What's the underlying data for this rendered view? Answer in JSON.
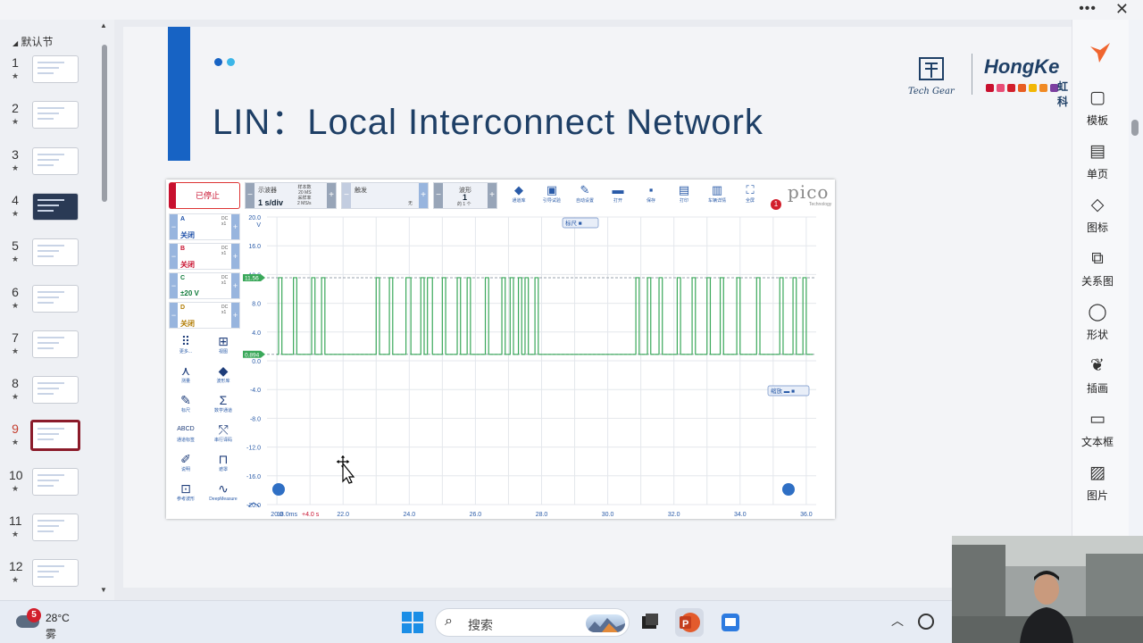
{
  "window": {
    "more_label": "•••",
    "close_label": "✕"
  },
  "thumbnails": {
    "section_label": "默认节",
    "collapse_glyph": "◢",
    "star": "★",
    "items": [
      {
        "num": "1"
      },
      {
        "num": "2"
      },
      {
        "num": "3"
      },
      {
        "num": "4"
      },
      {
        "num": "5"
      },
      {
        "num": "6"
      },
      {
        "num": "7"
      },
      {
        "num": "8"
      },
      {
        "num": "9"
      },
      {
        "num": "10"
      },
      {
        "num": "11"
      },
      {
        "num": "12"
      }
    ],
    "active_num": "9"
  },
  "slide": {
    "title": "LIN：Local  Interconnect  Network",
    "logo_techgear": "Tech Gear",
    "logo_hongkei": "HongKe",
    "logo_cn": "虹科",
    "brand_colors": [
      "#1763c4",
      "#3cb6e8",
      "#c8102e",
      "#e94e77",
      "#d21f2c",
      "#e85d22",
      "#f2b705",
      "#f08a24",
      "#7c3fa0"
    ]
  },
  "scope": {
    "stop_label": "已停止",
    "timebase": {
      "label": "示波器",
      "value": "1 s/div",
      "samples_label": "样本数",
      "samples": "20 MS",
      "rate_label": "采样率",
      "rate": "2 MS/s"
    },
    "trigger": {
      "label": "触发",
      "mode": "无"
    },
    "waveform": {
      "label": "波形",
      "value": "1",
      "of": "的 1 个"
    },
    "toolbar": [
      {
        "name": "channel-library",
        "icon": "◆",
        "label": "通道库"
      },
      {
        "name": "guided-test",
        "icon": "▣",
        "label": "引导试验"
      },
      {
        "name": "auto-setup",
        "icon": "✎",
        "label": "自动设置"
      },
      {
        "name": "open",
        "icon": "▬",
        "label": "打开"
      },
      {
        "name": "save",
        "icon": "▪",
        "label": "保存"
      },
      {
        "name": "print",
        "icon": "▤",
        "label": "打印"
      },
      {
        "name": "vehicle-details",
        "icon": "▥",
        "label": "车辆详情"
      },
      {
        "name": "fullscreen",
        "icon": "⛶",
        "label": "全屏"
      }
    ],
    "notification_count": "1",
    "brand": "pico",
    "brand_sub": "Technology",
    "channels": [
      {
        "name": "A",
        "coupling": "DC",
        "probe": "x1",
        "state": "关闭",
        "color": "#1d4fa8"
      },
      {
        "name": "B",
        "coupling": "DC",
        "probe": "x1",
        "state": "关闭",
        "color": "#c8102e"
      },
      {
        "name": "C",
        "coupling": "DC",
        "probe": "x1",
        "state": "±20 V",
        "color": "#0f7a3a"
      },
      {
        "name": "D",
        "coupling": "DC",
        "probe": "x1",
        "state": "关闭",
        "color": "#b07a00"
      }
    ],
    "tools": [
      {
        "name": "more",
        "icon": "⠿",
        "label": "更多..."
      },
      {
        "name": "views",
        "icon": "⊞",
        "label": "视图"
      },
      {
        "name": "measurements",
        "icon": "⋏",
        "label": "测量"
      },
      {
        "name": "channel-library-tool",
        "icon": "◆",
        "label": "波形库"
      },
      {
        "name": "ruler",
        "icon": "✎",
        "label": "标尺"
      },
      {
        "name": "math-channels",
        "icon": "Σ",
        "label": "数学通道"
      },
      {
        "name": "channel-labels",
        "icon": "ABCD",
        "label": "通道标签"
      },
      {
        "name": "serial-decoding",
        "icon": "⤲",
        "label": "串行译码"
      },
      {
        "name": "notes",
        "icon": "✐",
        "label": "说明"
      },
      {
        "name": "mask",
        "icon": "⊓",
        "label": "遮罩"
      },
      {
        "name": "reference-waveforms",
        "icon": "⊡",
        "label": "参考波形"
      },
      {
        "name": "deepmeasure",
        "icon": "∿",
        "label": "DeepMeasure"
      }
    ],
    "ruler_tag": "标尺 ■",
    "zoom_tag": "缩放 ▬ ■",
    "level_high": "11.56",
    "level_low": "0.894",
    "x_start": "18.0ms",
    "x_offset": "+4.0 s",
    "accent_green": "#3aa85a"
  },
  "chart_data": {
    "type": "line",
    "series": [
      {
        "name": "C",
        "transitions_s": [
          20.05,
          20.15,
          20.5,
          20.6,
          21.05,
          21.15,
          21.35,
          21.45,
          23.0,
          23.1,
          23.4,
          23.5,
          23.9,
          24.05,
          24.35,
          24.45,
          24.55,
          24.7,
          25.0,
          25.1,
          25.45,
          25.55,
          25.75,
          25.85,
          26.3,
          26.4,
          26.8,
          26.9,
          27.05,
          27.15,
          27.3,
          27.4,
          27.5,
          27.6,
          27.8,
          27.9,
          30.85,
          30.95,
          31.2,
          31.3,
          31.55,
          31.65,
          32.1,
          32.2,
          32.55,
          32.65,
          33.0,
          33.1,
          33.4,
          33.5,
          33.9,
          34.0,
          34.5,
          34.6,
          35.2,
          35.3,
          35.6,
          35.7,
          35.9,
          36.0
        ],
        "y_high": 11.56,
        "y_low": 0.894
      }
    ],
    "x_ticks": [
      "20.0",
      "22.0",
      "24.0",
      "26.0",
      "28.0",
      "30.0",
      "32.0",
      "34.0",
      "36.0"
    ],
    "y_ticks": [
      "20.0",
      "16.0",
      "12.0",
      "8.0",
      "4.0",
      "0.0",
      "-4.0",
      "-8.0",
      "-12.0",
      "-16.0",
      "-20.0"
    ],
    "y_unit": "V",
    "xlim": [
      19.7,
      36.3
    ],
    "ylim": [
      -20,
      20
    ],
    "grid": true
  },
  "ribbon": {
    "items": [
      {
        "name": "template",
        "icon": "▢",
        "label": "模板"
      },
      {
        "name": "single-page",
        "icon": "▤",
        "label": "单页"
      },
      {
        "name": "icons",
        "icon": "◇",
        "label": "图标"
      },
      {
        "name": "relationship-chart",
        "icon": "⧉",
        "label": "关系图"
      },
      {
        "name": "shapes",
        "icon": "◯",
        "label": "形状"
      },
      {
        "name": "illustration",
        "icon": "❦",
        "label": "插画"
      },
      {
        "name": "textbox",
        "icon": "▭",
        "label": "文本框"
      },
      {
        "name": "picture",
        "icon": "▨",
        "label": "图片"
      }
    ]
  },
  "taskbar": {
    "weather_badge": "5",
    "temperature": "28°C",
    "condition": "雾",
    "search_placeholder": "搜索",
    "tray_chevron": "︿"
  }
}
